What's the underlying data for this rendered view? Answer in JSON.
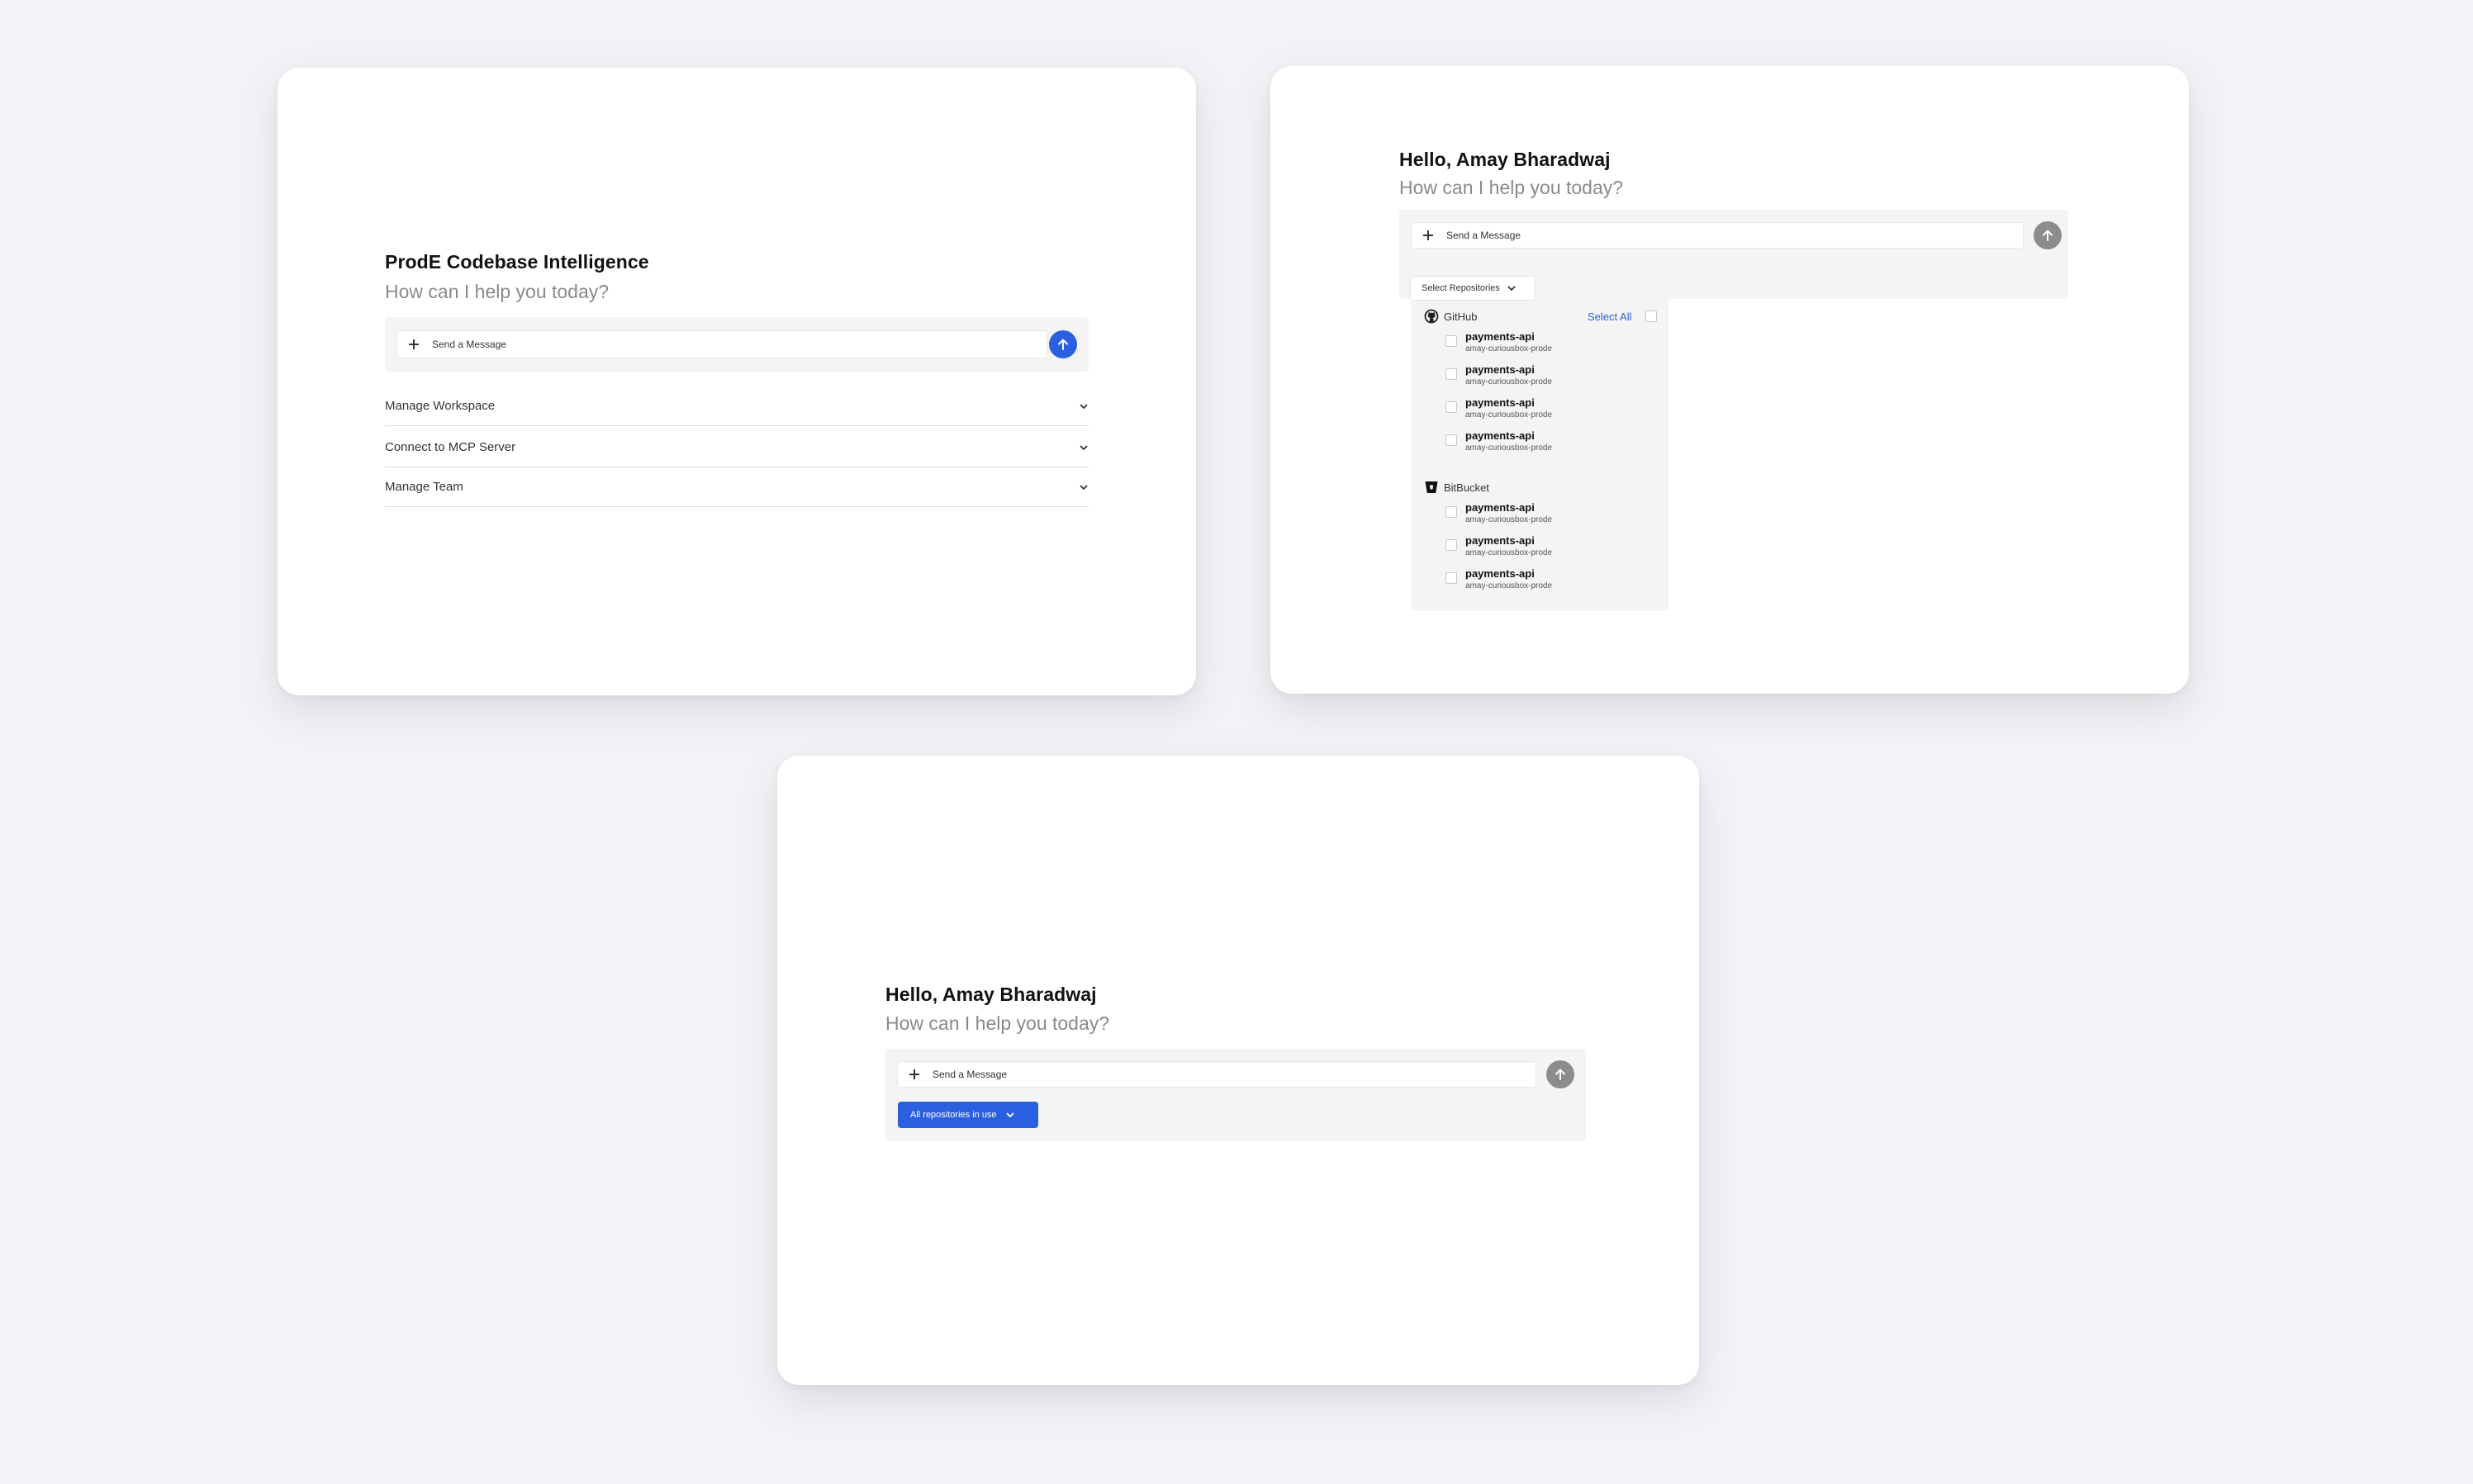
{
  "colors": {
    "page_background": "#f2f3f6",
    "accent_blue": "#2a5fe0",
    "send_disabled_gray": "#8c8c8c",
    "link_blue": "#2d5fd9"
  },
  "card1": {
    "title": "ProdE Codebase Intelligence",
    "subtitle": "How can I help you today?",
    "input": {
      "placeholder": "Send a Message",
      "icon": "plus-icon"
    },
    "send_icon": "arrow-up-icon",
    "accordion": [
      {
        "label": "Manage Workspace",
        "icon": "chevron-down-icon"
      },
      {
        "label": "Connect to MCP Server",
        "icon": "chevron-down-icon"
      },
      {
        "label": "Manage Team",
        "icon": "chevron-down-icon"
      }
    ]
  },
  "card2": {
    "title": "Hello, Amay Bharadwaj",
    "subtitle": "How can I help you today?",
    "input": {
      "placeholder": "Send a Message",
      "icon": "plus-icon"
    },
    "send_icon": "arrow-up-icon",
    "repo_select": {
      "label": "Select Repositories",
      "icon": "chevron-down-icon"
    },
    "dropdown": {
      "select_all": "Select All",
      "providers": [
        {
          "name": "GitHub",
          "icon": "github-icon",
          "repos": [
            {
              "name": "payments-api",
              "owner": "amay-curiousbox-prode"
            },
            {
              "name": "payments-api",
              "owner": "amay-curiousbox-prode"
            },
            {
              "name": "payments-api",
              "owner": "amay-curiousbox-prode"
            },
            {
              "name": "payments-api",
              "owner": "amay-curiousbox-prode"
            }
          ]
        },
        {
          "name": "BitBucket",
          "icon": "bitbucket-icon",
          "repos": [
            {
              "name": "payments-api",
              "owner": "amay-curiousbox-prode"
            },
            {
              "name": "payments-api",
              "owner": "amay-curiousbox-prode"
            },
            {
              "name": "payments-api",
              "owner": "amay-curiousbox-prode"
            }
          ]
        }
      ]
    }
  },
  "card3": {
    "title": "Hello, Amay Bharadwaj",
    "subtitle": "How can I help you today?",
    "input": {
      "placeholder": "Send a Message",
      "icon": "plus-icon"
    },
    "send_icon": "arrow-up-icon",
    "repo_button": {
      "label": "All repositories in use",
      "icon": "chevron-down-icon"
    }
  }
}
